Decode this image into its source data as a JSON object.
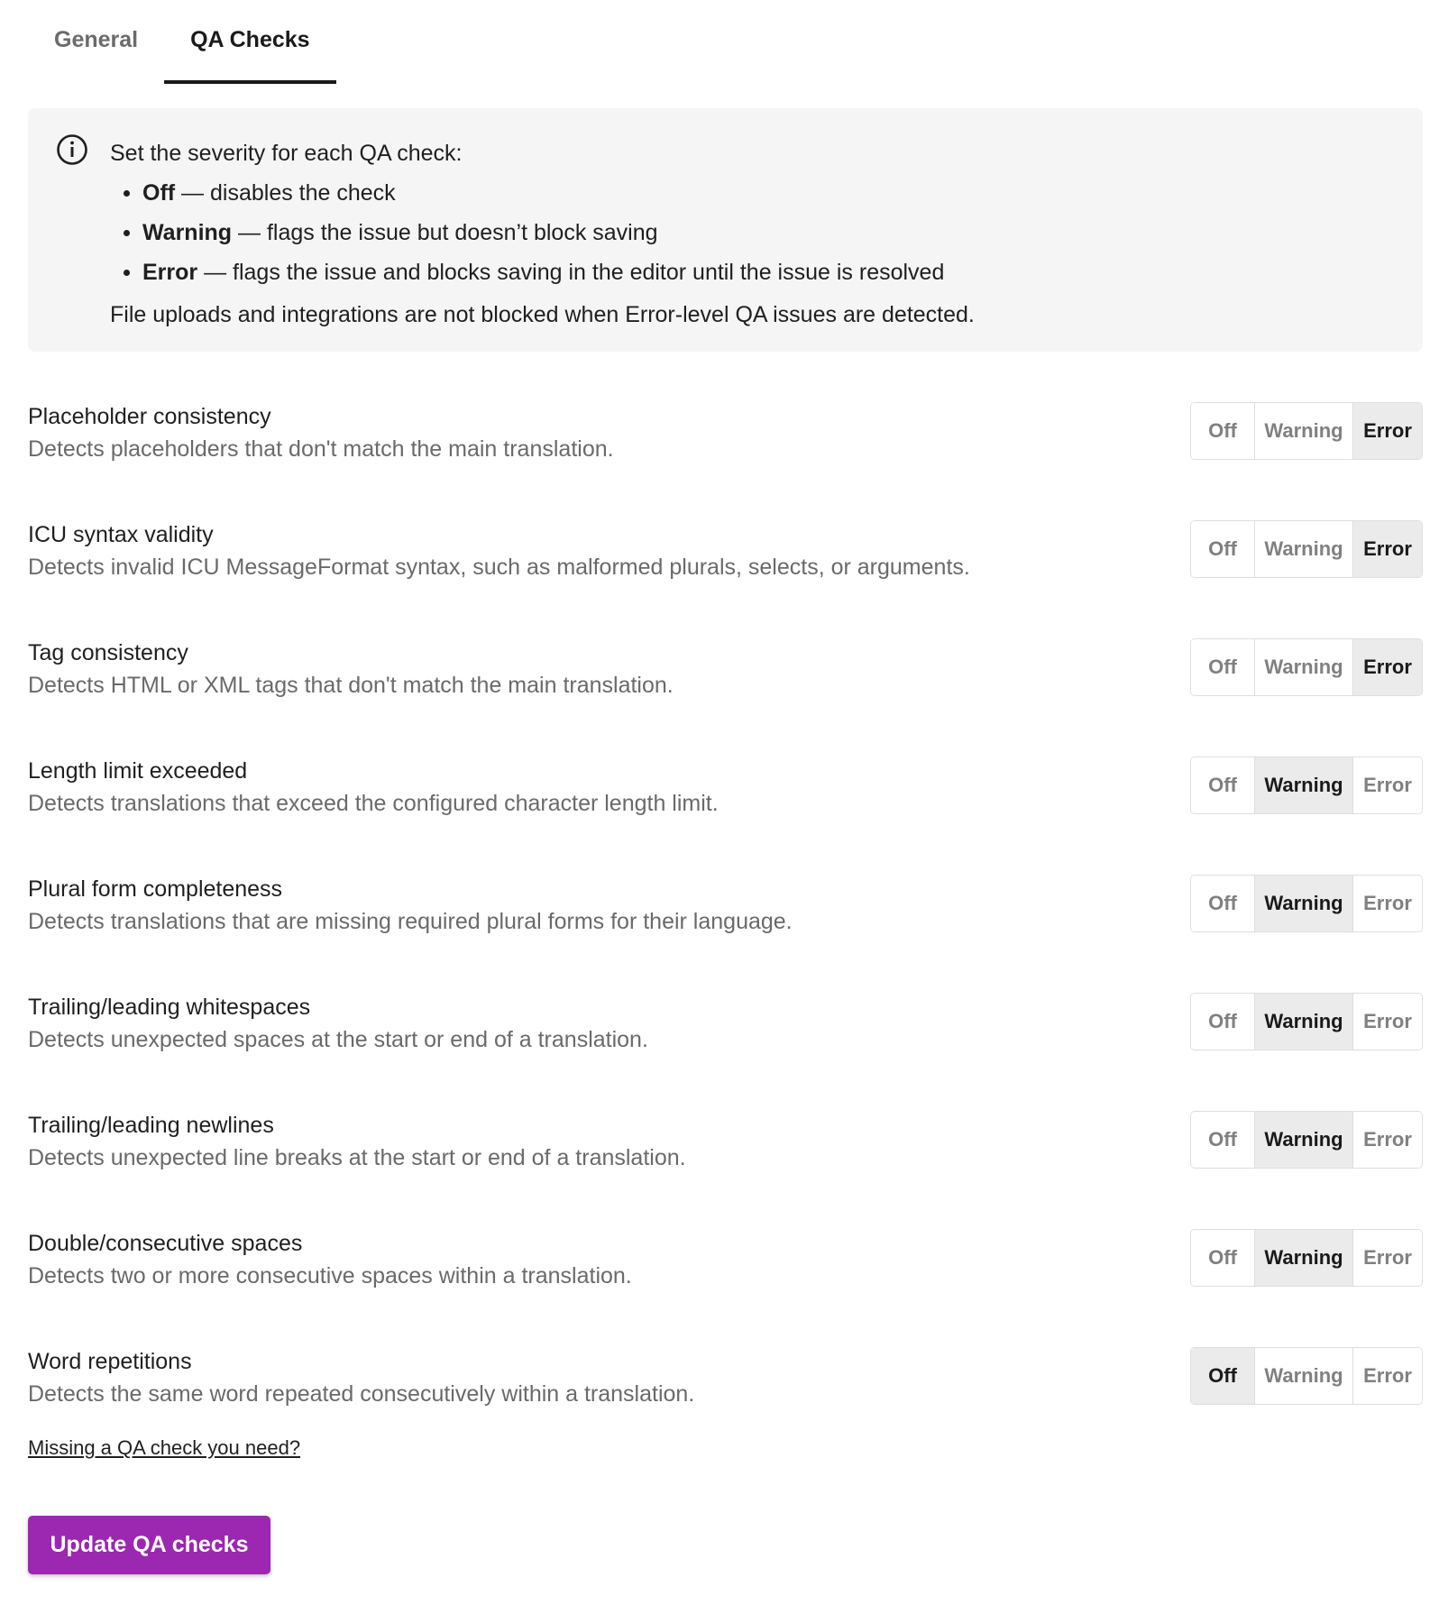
{
  "tabs": [
    {
      "label": "General",
      "active": false
    },
    {
      "label": "QA Checks",
      "active": true
    }
  ],
  "info": {
    "icon": "info-icon",
    "lead": "Set the severity for each QA check:",
    "items": [
      {
        "term": "Off",
        "text": " — disables the check"
      },
      {
        "term": "Warning",
        "text": " — flags the issue but doesn’t block saving"
      },
      {
        "term": "Error",
        "text": " — flags the issue and blocks saving in the editor until the issue is resolved"
      }
    ],
    "footer": "File uploads and integrations are not blocked when Error-level QA issues are detected."
  },
  "severity_options": [
    "Off",
    "Warning",
    "Error"
  ],
  "checks": [
    {
      "title": "Placeholder consistency",
      "description": "Detects placeholders that don't match the main translation.",
      "selected": "Error"
    },
    {
      "title": "ICU syntax validity",
      "description": "Detects invalid ICU MessageFormat syntax, such as malformed plurals, selects, or arguments.",
      "selected": "Error"
    },
    {
      "title": "Tag consistency",
      "description": "Detects HTML or XML tags that don't match the main translation.",
      "selected": "Error"
    },
    {
      "title": "Length limit exceeded",
      "description": "Detects translations that exceed the configured character length limit.",
      "selected": "Warning"
    },
    {
      "title": "Plural form completeness",
      "description": "Detects translations that are missing required plural forms for their language.",
      "selected": "Warning"
    },
    {
      "title": "Trailing/leading whitespaces",
      "description": "Detects unexpected spaces at the start or end of a translation.",
      "selected": "Warning"
    },
    {
      "title": "Trailing/leading newlines",
      "description": "Detects unexpected line breaks at the start or end of a translation.",
      "selected": "Warning"
    },
    {
      "title": "Double/consecutive spaces",
      "description": "Detects two or more consecutive spaces within a translation.",
      "selected": "Warning"
    },
    {
      "title": "Word repetitions",
      "description": "Detects the same word repeated consecutively within a translation.",
      "selected": "Off"
    }
  ],
  "missing_link": "Missing a QA check you need?",
  "update_button": "Update QA checks",
  "colors": {
    "accent": "#9c27b0",
    "selected_segment": "#ebebeb",
    "info_background": "#f5f5f5"
  }
}
